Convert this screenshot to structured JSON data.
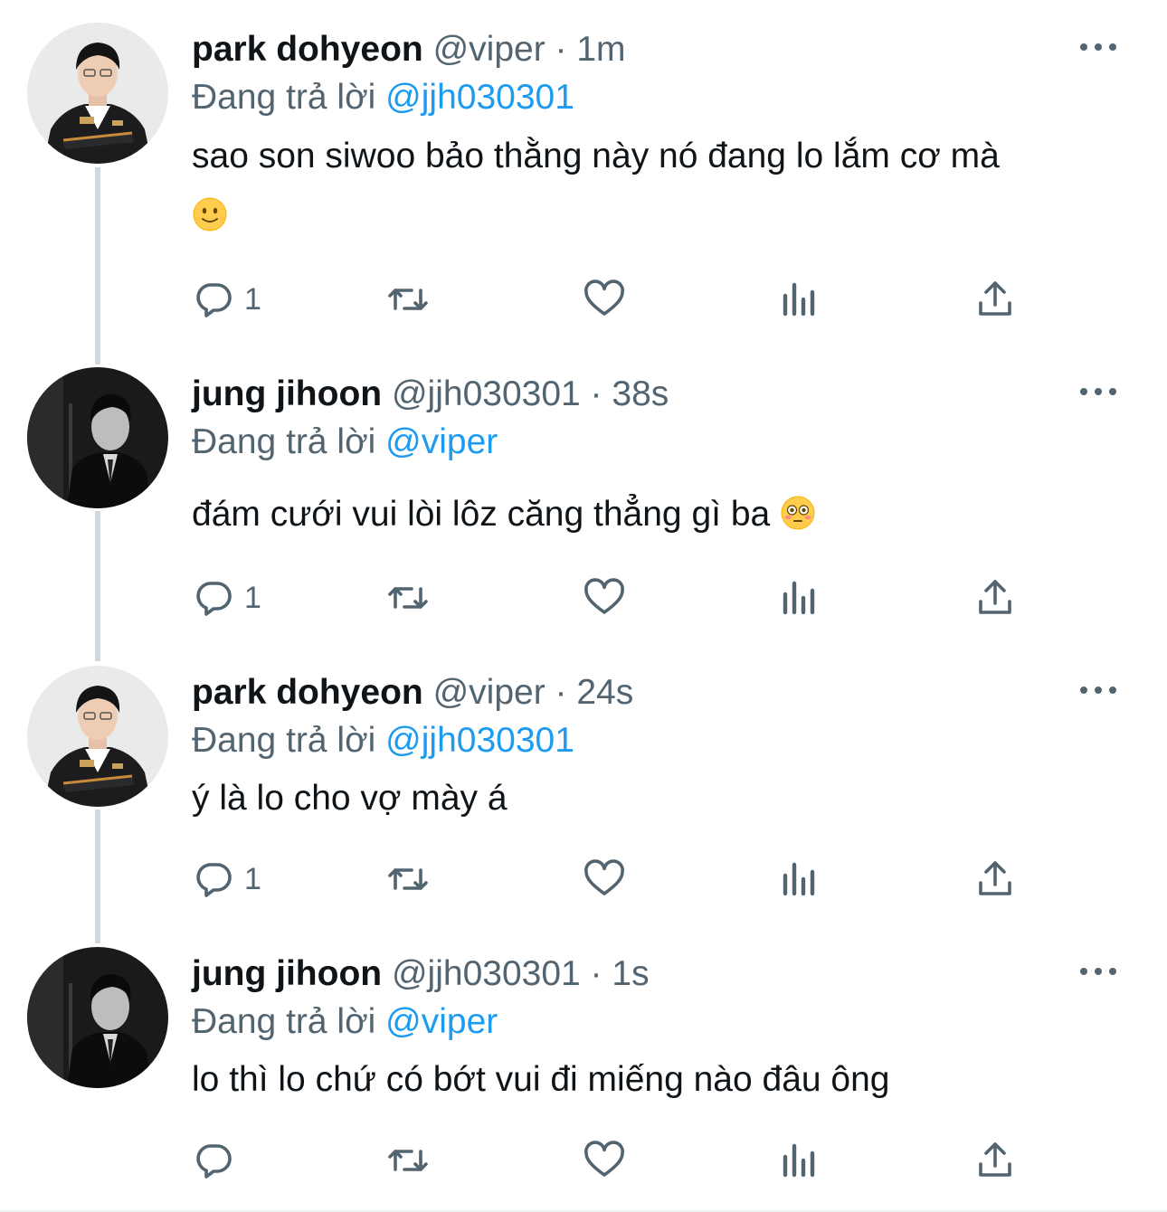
{
  "tweets": [
    {
      "author_name": "park dohyeon",
      "handle": "@viper",
      "separator": " · ",
      "time": "1m",
      "replying_prefix": "Đang trả lời ",
      "replying_to": "@jjh030301",
      "text": "sao son siwoo bảo thằng này nó đang lo lắm cơ mà",
      "emoji": "slightly-smiling-face",
      "reply_count": "1",
      "avatar": "dark-jacket-player-light-bg"
    },
    {
      "author_name": "jung jihoon",
      "handle": "@jjh030301",
      "separator": " · ",
      "time": "38s",
      "replying_prefix": "Đang trả lời ",
      "replying_to": "@viper",
      "text": "đám cưới vui lòi lôz căng thẳng gì ba",
      "emoji": "flushed-face",
      "reply_count": "1",
      "avatar": "suit-portrait-bw"
    },
    {
      "author_name": "park dohyeon",
      "handle": "@viper",
      "separator": " · ",
      "time": "24s",
      "replying_prefix": "Đang trả lời ",
      "replying_to": "@jjh030301",
      "text": "ý là lo cho vợ mày á",
      "reply_count": "1",
      "avatar": "dark-jacket-player-light-bg"
    },
    {
      "author_name": "jung jihoon",
      "handle": "@jjh030301",
      "separator": " · ",
      "time": "1s",
      "replying_prefix": "Đang trả lời ",
      "replying_to": "@viper",
      "text": "lo thì lo chứ có bớt vui đi miếng nào đâu ông",
      "reply_count": "",
      "avatar": "suit-portrait-bw"
    }
  ],
  "colors": {
    "text": "#0f1419",
    "secondary": "#536471",
    "accent": "#1d9bf0",
    "thread_line": "#cfd9de"
  },
  "icons": {
    "reply": "speech-bubble-icon",
    "retweet": "retweet-arrows-icon",
    "like": "heart-icon",
    "views": "bar-chart-icon",
    "share": "share-upload-icon",
    "more": "more-dots-icon"
  }
}
